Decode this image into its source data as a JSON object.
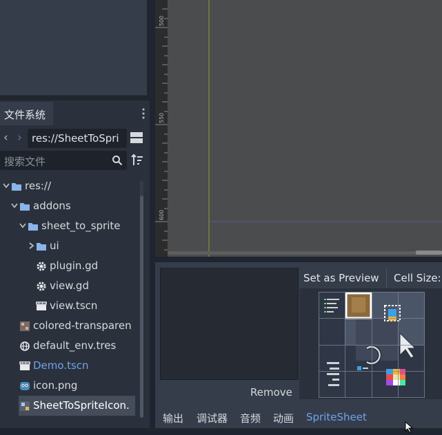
{
  "filesystem": {
    "tab_label": "文件系统",
    "path": "res://SheetToSpri",
    "search_placeholder": "搜索文件",
    "tree": [
      {
        "label": "res://",
        "kind": "folder",
        "expanded": true,
        "color": "#d6d9de"
      },
      {
        "label": "addons",
        "kind": "folder",
        "expanded": true,
        "color": "#d6d9de"
      },
      {
        "label": "sheet_to_sprite",
        "kind": "folder",
        "expanded": true,
        "color": "#d6d9de"
      },
      {
        "label": "ui",
        "kind": "folder",
        "expanded": false,
        "color": "#d6d9de"
      },
      {
        "label": "plugin.gd",
        "kind": "gear",
        "color": "#d6d9de"
      },
      {
        "label": "view.gd",
        "kind": "gear",
        "color": "#d6d9de"
      },
      {
        "label": "view.tscn",
        "kind": "scene",
        "color": "#d6d9de"
      },
      {
        "label": "colored-transparen",
        "kind": "image",
        "color": "#d6d9de"
      },
      {
        "label": "default_env.tres",
        "kind": "globe",
        "color": "#d6d9de"
      },
      {
        "label": "Demo.tscn",
        "kind": "scene",
        "color": "#6ea3ee"
      },
      {
        "label": "icon.png",
        "kind": "image",
        "color": "#d6d9de"
      },
      {
        "label": "SheetToSpriteIcon.",
        "kind": "image",
        "color": "#ffffff",
        "selected": true
      }
    ]
  },
  "ruler": {
    "labels": [
      "500",
      "550",
      "600"
    ]
  },
  "spritesheet_panel": {
    "remove_label": "Remove",
    "set_preview_label": "Set as Preview",
    "cell_size_label": "Cell Size:"
  },
  "bottom_tabs": [
    "输出",
    "调试器",
    "音频",
    "动画",
    "SpriteSheet"
  ],
  "colors": {
    "accent": "#6ea3ee",
    "panel": "#363d4a",
    "dark": "#20252e"
  }
}
